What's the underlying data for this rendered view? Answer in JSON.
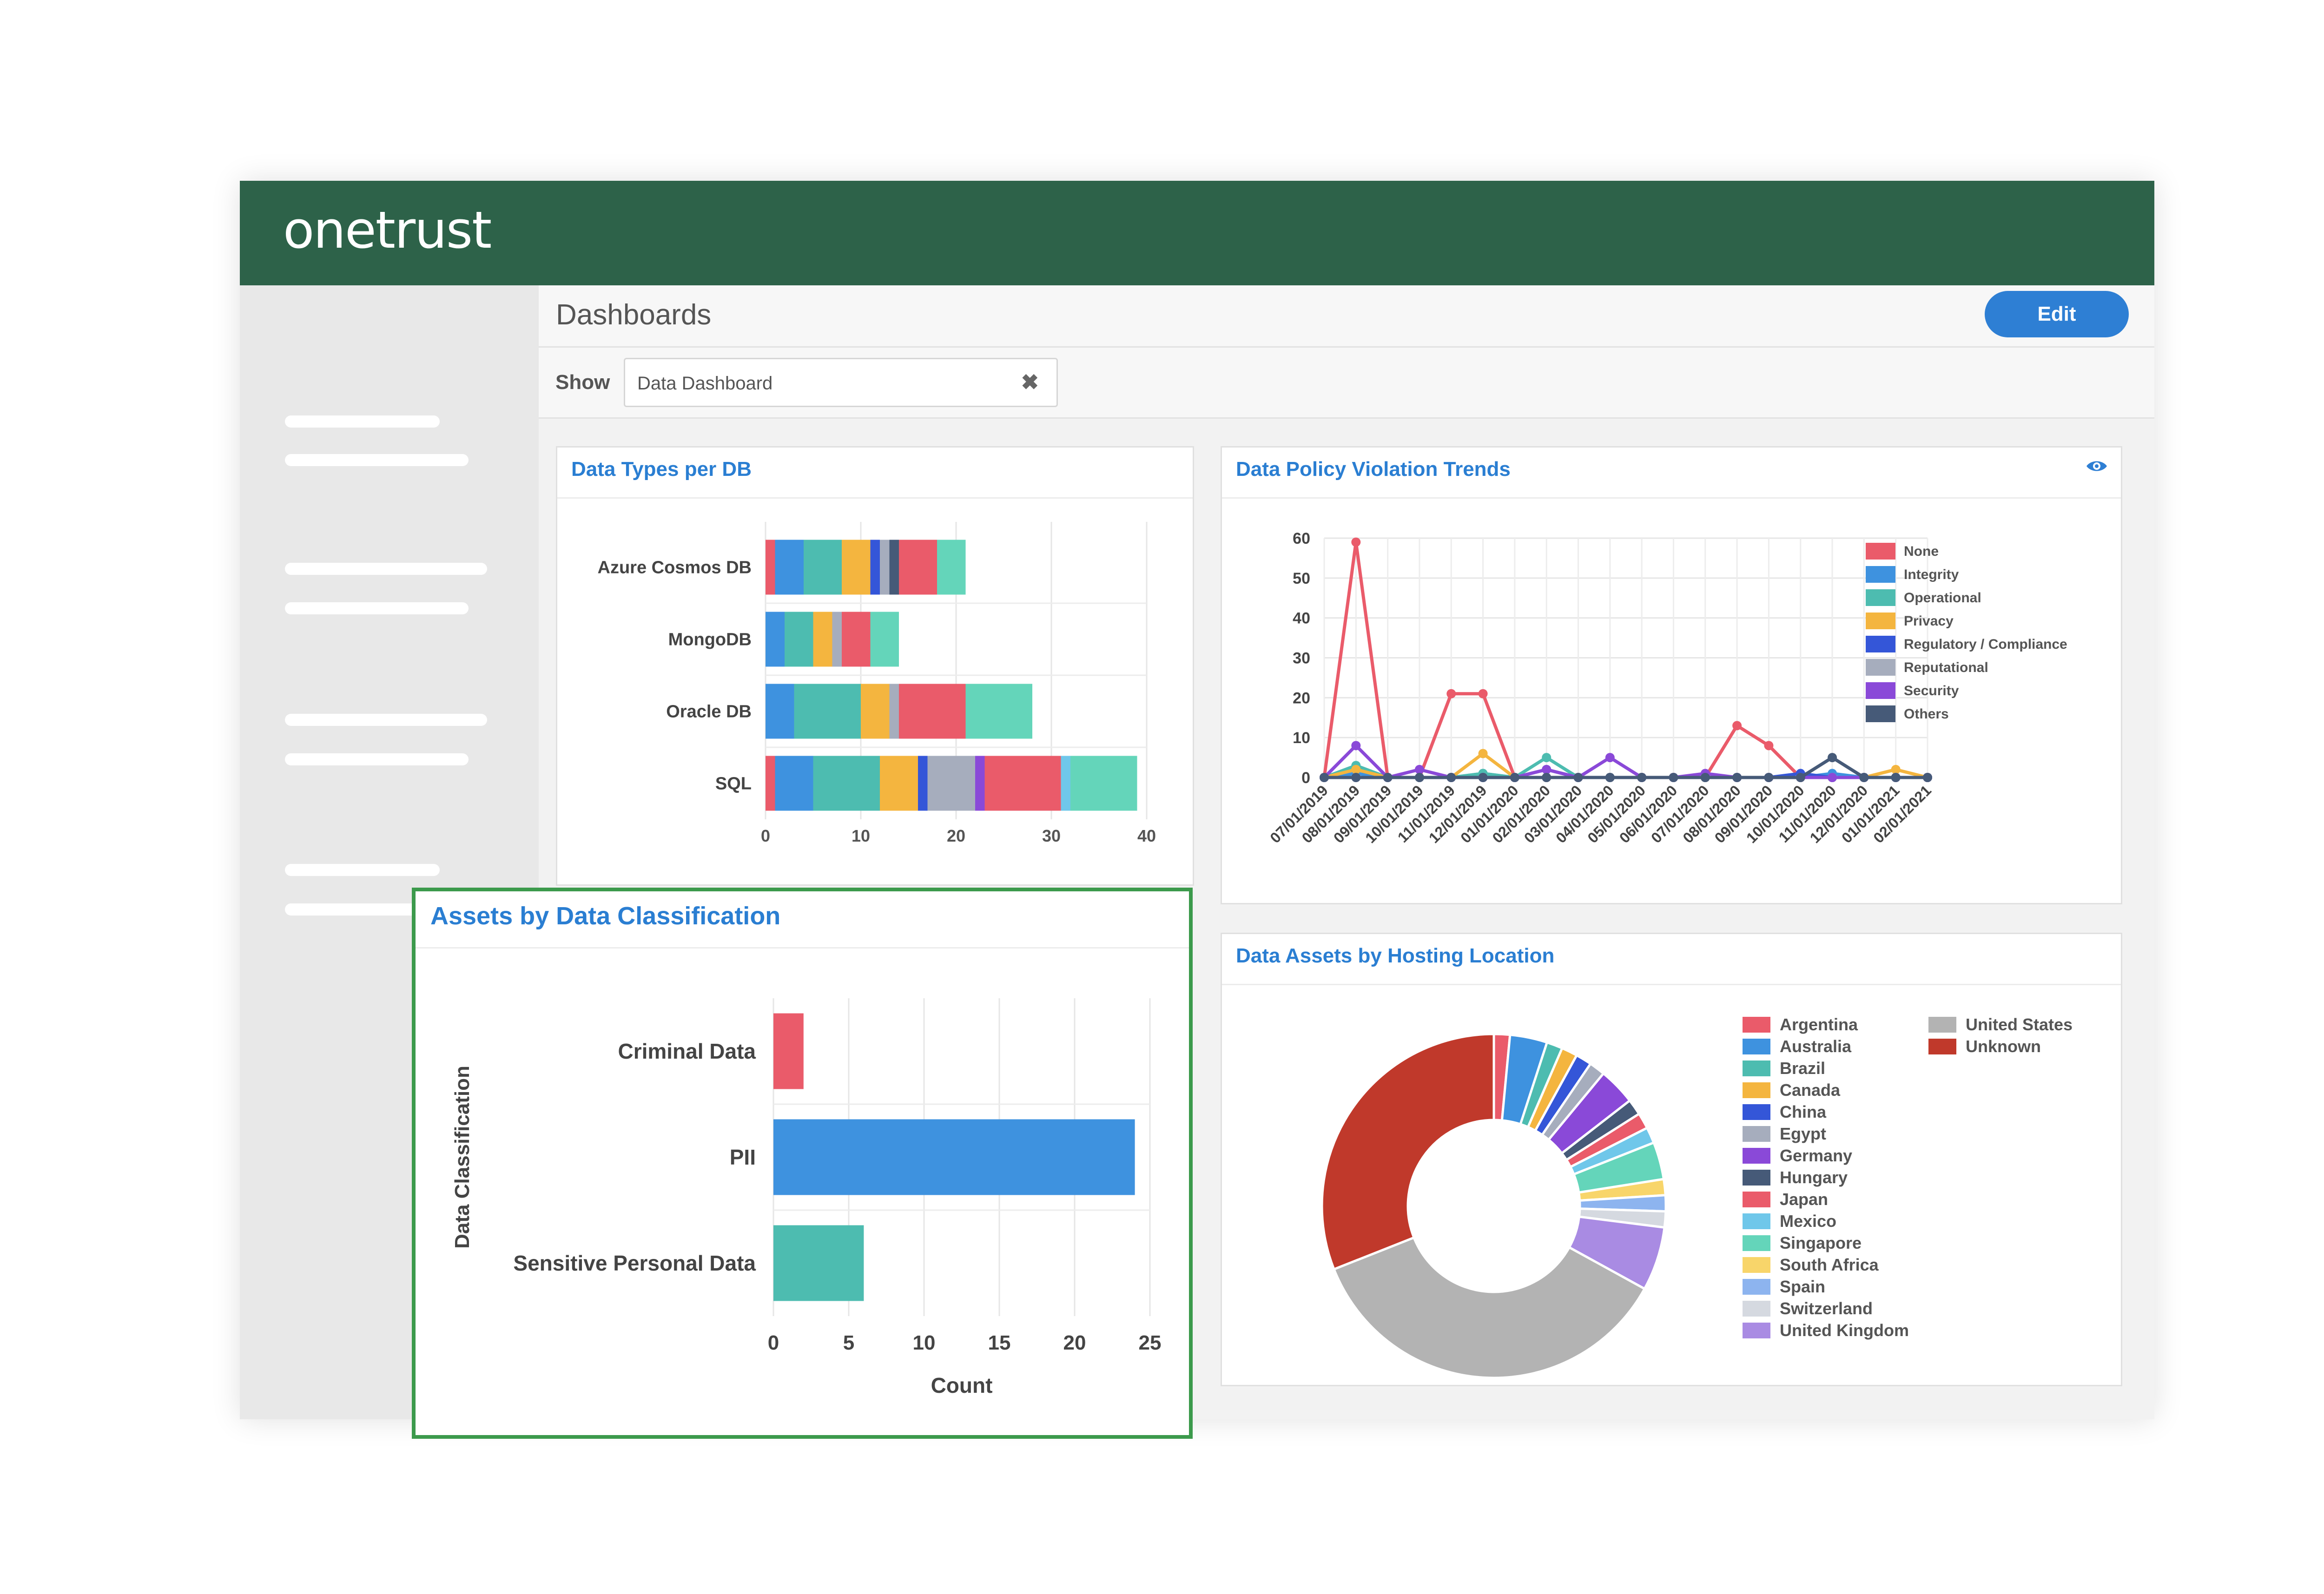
{
  "app": {
    "logo": "onetrust"
  },
  "header": {
    "title": "Dashboards",
    "edit_label": "Edit"
  },
  "show": {
    "label": "Show",
    "value": "Data Dashboard",
    "clear_glyph": "✖"
  },
  "colors": {
    "brand_green": "#2d6249",
    "accent_blue": "#2e7fd4",
    "highlight_green": "#3c9a4c"
  },
  "icons": {
    "eye": "eye-icon",
    "clear": "close-icon"
  },
  "chart_data": [
    {
      "type": "bar",
      "orientation": "horizontal",
      "stacked": true,
      "title": "Data Types per DB",
      "categories": [
        "Azure Cosmos DB",
        "MongoDB",
        "Oracle DB",
        "SQL"
      ],
      "xlim": [
        0,
        40
      ],
      "xticks": [
        "0",
        "10",
        "20",
        "30",
        "40"
      ],
      "grid": true,
      "segments": [
        [
          {
            "v": 1,
            "c": "#ea5b6a"
          },
          {
            "v": 3,
            "c": "#3e92df"
          },
          {
            "v": 4,
            "c": "#4dbcb0"
          },
          {
            "v": 3,
            "c": "#f4b53f"
          },
          {
            "v": 1,
            "c": "#3456d8"
          },
          {
            "v": 1,
            "c": "#a6adbd"
          },
          {
            "v": 1,
            "c": "#465a78"
          },
          {
            "v": 4,
            "c": "#ea5b6a"
          },
          {
            "v": 3,
            "c": "#64d5ba"
          }
        ],
        [
          {
            "v": 2,
            "c": "#3e92df"
          },
          {
            "v": 3,
            "c": "#4dbcb0"
          },
          {
            "v": 2,
            "c": "#f4b53f"
          },
          {
            "v": 1,
            "c": "#a6adbd"
          },
          {
            "v": 3,
            "c": "#ea5b6a"
          },
          {
            "v": 3,
            "c": "#64d5ba"
          }
        ],
        [
          {
            "v": 3,
            "c": "#3e92df"
          },
          {
            "v": 7,
            "c": "#4dbcb0"
          },
          {
            "v": 3,
            "c": "#f4b53f"
          },
          {
            "v": 1,
            "c": "#a6adbd"
          },
          {
            "v": 7,
            "c": "#ea5b6a"
          },
          {
            "v": 7,
            "c": "#64d5ba"
          }
        ],
        [
          {
            "v": 1,
            "c": "#ea5b6a"
          },
          {
            "v": 4,
            "c": "#3e92df"
          },
          {
            "v": 7,
            "c": "#4dbcb0"
          },
          {
            "v": 4,
            "c": "#f4b53f"
          },
          {
            "v": 1,
            "c": "#3456d8"
          },
          {
            "v": 5,
            "c": "#a6adbd"
          },
          {
            "v": 1,
            "c": "#8a49d8"
          },
          {
            "v": 8,
            "c": "#ea5b6a"
          },
          {
            "v": 1,
            "c": "#6fc7ea"
          },
          {
            "v": 7,
            "c": "#64d5ba"
          }
        ]
      ]
    },
    {
      "type": "line",
      "title": "Data Policy Violation Trends",
      "x": [
        "07/01/2019",
        "08/01/2019",
        "09/01/2019",
        "10/01/2019",
        "11/01/2019",
        "12/01/2019",
        "01/01/2020",
        "02/01/2020",
        "03/01/2020",
        "04/01/2020",
        "05/01/2020",
        "06/01/2020",
        "07/01/2020",
        "08/01/2020",
        "09/01/2020",
        "10/01/2020",
        "11/01/2020",
        "12/01/2020",
        "01/01/2021",
        "02/01/2021"
      ],
      "ylim": [
        0,
        60
      ],
      "yticks": [
        "0",
        "10",
        "20",
        "30",
        "40",
        "50",
        "60"
      ],
      "grid": true,
      "legend_position": "right",
      "series": [
        {
          "name": "None",
          "color": "#ea5b6a",
          "values": [
            0,
            59,
            0,
            0,
            21,
            21,
            0,
            0,
            0,
            0,
            0,
            0,
            0,
            13,
            8,
            0,
            0,
            0,
            0,
            0
          ]
        },
        {
          "name": "Integrity",
          "color": "#3e92df",
          "values": [
            0,
            1,
            0,
            0,
            0,
            1,
            0,
            2,
            0,
            0,
            0,
            0,
            0,
            0,
            0,
            0,
            1,
            0,
            0,
            0
          ]
        },
        {
          "name": "Operational",
          "color": "#4dbcb0",
          "values": [
            0,
            3,
            0,
            0,
            0,
            1,
            0,
            5,
            0,
            0,
            0,
            0,
            0,
            0,
            0,
            0,
            0,
            0,
            0,
            0
          ]
        },
        {
          "name": "Privacy",
          "color": "#f4b53f",
          "values": [
            0,
            2,
            0,
            0,
            0,
            6,
            0,
            0,
            0,
            0,
            0,
            0,
            0,
            0,
            0,
            0,
            0,
            0,
            2,
            0
          ]
        },
        {
          "name": "Regulatory / Compliance",
          "color": "#3456d8",
          "values": [
            0,
            0,
            0,
            0,
            0,
            0,
            0,
            0,
            0,
            0,
            0,
            0,
            0,
            0,
            0,
            1,
            0,
            0,
            0,
            0
          ]
        },
        {
          "name": "Reputational",
          "color": "#a6adbd",
          "values": [
            0,
            0,
            0,
            0,
            0,
            0,
            0,
            0,
            0,
            0,
            0,
            0,
            0,
            0,
            0,
            0,
            0,
            0,
            0,
            0
          ]
        },
        {
          "name": "Security",
          "color": "#8a49d8",
          "values": [
            0,
            8,
            0,
            2,
            0,
            0,
            0,
            2,
            0,
            5,
            0,
            0,
            1,
            0,
            0,
            0,
            0,
            0,
            0,
            0
          ]
        },
        {
          "name": "Others",
          "color": "#465a78",
          "values": [
            0,
            0,
            0,
            0,
            0,
            0,
            0,
            0,
            0,
            0,
            0,
            0,
            0,
            0,
            0,
            0,
            5,
            0,
            0,
            0
          ]
        }
      ]
    },
    {
      "type": "pie",
      "donut": true,
      "title": "Data Assets by Hosting Location",
      "legend_position": "right",
      "slices": [
        {
          "name": "Argentina",
          "value": 1.5,
          "color": "#ea5b6a"
        },
        {
          "name": "Australia",
          "value": 3.5,
          "color": "#3e92df"
        },
        {
          "name": "Brazil",
          "value": 1.5,
          "color": "#4dbcb0"
        },
        {
          "name": "Canada",
          "value": 1.5,
          "color": "#f4b53f"
        },
        {
          "name": "China",
          "value": 1.5,
          "color": "#3456d8"
        },
        {
          "name": "Egypt",
          "value": 1.5,
          "color": "#a6adbd"
        },
        {
          "name": "Germany",
          "value": 3.5,
          "color": "#8a49d8"
        },
        {
          "name": "Hungary",
          "value": 1.5,
          "color": "#465a78"
        },
        {
          "name": "Japan",
          "value": 1.5,
          "color": "#ea5b6a"
        },
        {
          "name": "Mexico",
          "value": 1.5,
          "color": "#6fc7ea"
        },
        {
          "name": "Singapore",
          "value": 3.5,
          "color": "#64d5ba"
        },
        {
          "name": "South Africa",
          "value": 1.5,
          "color": "#f8d56a"
        },
        {
          "name": "Spain",
          "value": 1.5,
          "color": "#8db4ef"
        },
        {
          "name": "Switzerland",
          "value": 1.5,
          "color": "#d5d9e0"
        },
        {
          "name": "United Kingdom",
          "value": 6,
          "color": "#a98be3"
        },
        {
          "name": "United States",
          "value": 36,
          "color": "#b3b3b3"
        },
        {
          "name": "Unknown",
          "value": 31,
          "color": "#c0392b"
        }
      ]
    },
    {
      "type": "bar",
      "orientation": "horizontal",
      "title": "Assets by Data Classification",
      "categories": [
        "Criminal Data",
        "PII",
        "Sensitive Personal Data"
      ],
      "values": [
        2,
        24,
        6
      ],
      "colors": [
        "#ea5b6a",
        "#3e92df",
        "#4dbcb0"
      ],
      "xlim": [
        0,
        25
      ],
      "xticks": [
        "0",
        "5",
        "10",
        "15",
        "20",
        "25"
      ],
      "xlabel": "Count",
      "ylabel": "Data Classification",
      "grid": true
    }
  ]
}
